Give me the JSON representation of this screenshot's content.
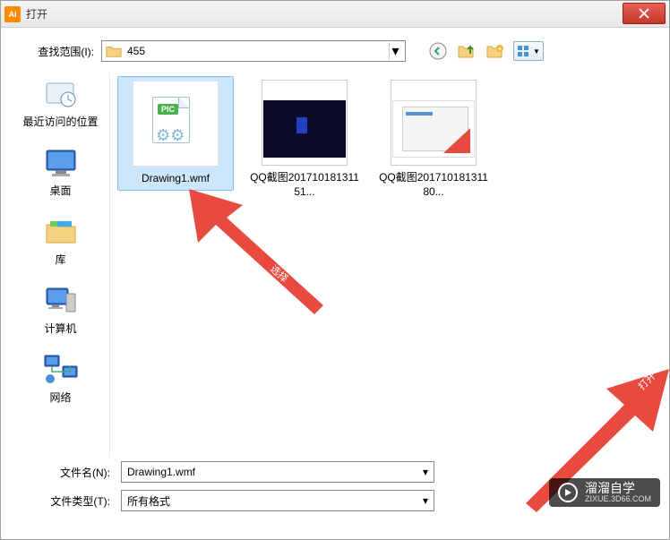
{
  "titlebar": {
    "app_icon_text": "Ai",
    "title": "打开"
  },
  "lookin": {
    "label": "查找范围(I):",
    "folder_name": "455"
  },
  "places": {
    "recent": "最近访问的位置",
    "desktop": "桌面",
    "libraries": "库",
    "computer": "计算机",
    "network": "网络"
  },
  "files": [
    {
      "name": "Drawing1.wmf",
      "type": "pic",
      "selected": true
    },
    {
      "name": "QQ截图20171018131151...",
      "type": "screenshot1",
      "selected": false
    },
    {
      "name": "QQ截图20171018131180...",
      "type": "screenshot2",
      "selected": false
    }
  ],
  "bottom": {
    "filename_label": "文件名(N):",
    "filename_value": "Drawing1.wmf",
    "filetype_label": "文件类型(T):",
    "filetype_value": "所有格式"
  },
  "watermark": {
    "text": "溜溜自学",
    "sub": "ZIXUE.3D66.COM"
  },
  "arrow_annotation": "选择"
}
